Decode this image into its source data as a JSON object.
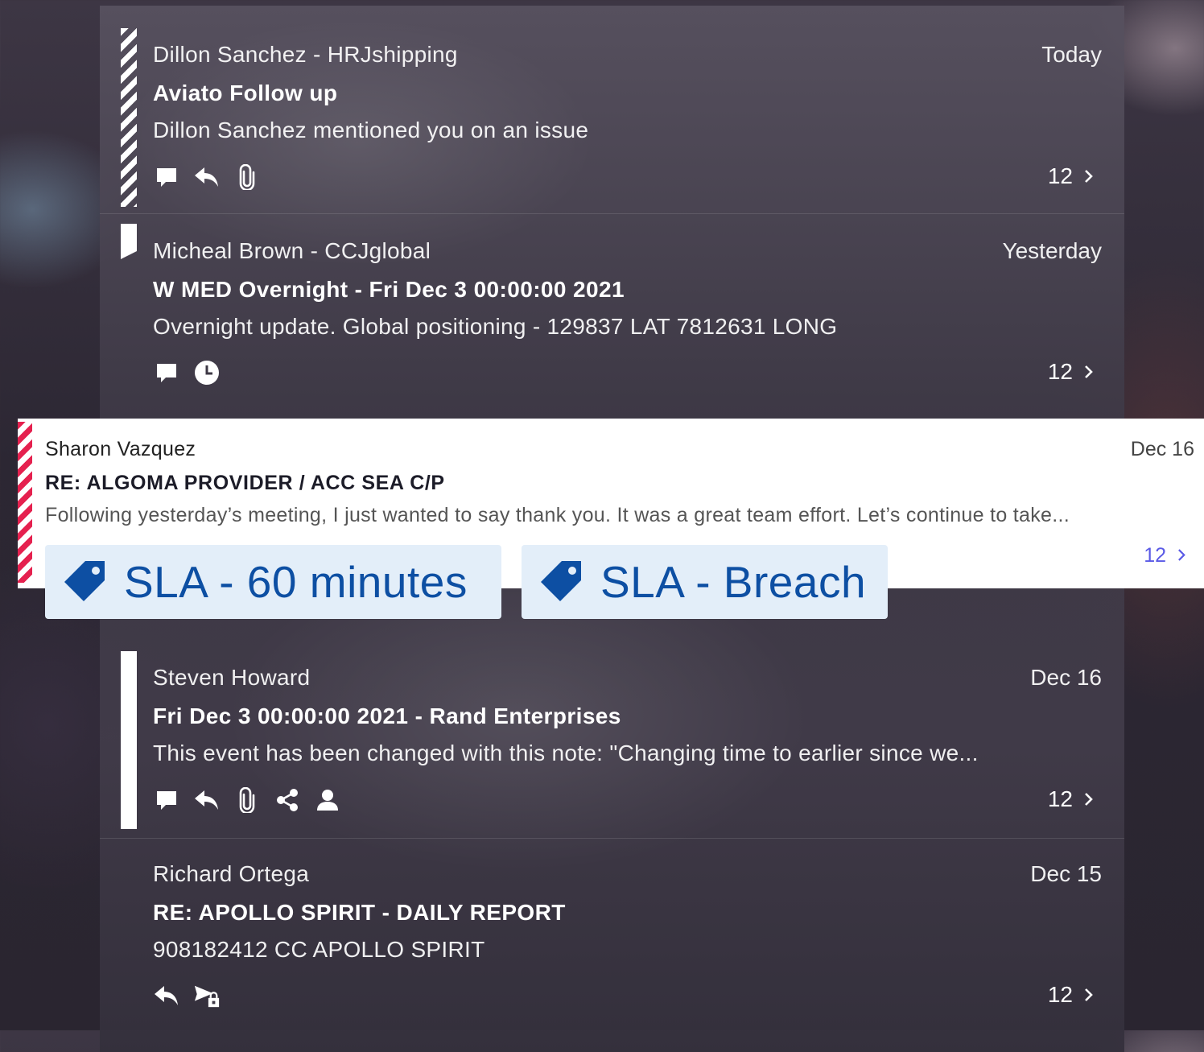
{
  "messages": [
    {
      "sender": "Dillon Sanchez - HRJshipping",
      "date": "Today",
      "subject": "Aviato Follow up",
      "preview": "Dillon Sanchez mentioned you on an issue",
      "count": "12",
      "icons": [
        "comment-icon",
        "reply-icon",
        "attachment-icon"
      ]
    },
    {
      "sender": "Micheal Brown - CCJglobal",
      "date": "Yesterday",
      "subject": "W MED Overnight - Fri Dec  3 00:00:00 2021",
      "preview": "Overnight update. Global positioning - 129837 LAT 7812631 LONG",
      "count": "12",
      "icons": [
        "comment-icon",
        "clock-icon"
      ]
    },
    {
      "sender": "Sharon Vazquez",
      "date": "Dec 16",
      "subject": "RE: ALGOMA PROVIDER / ACC SEA C/P",
      "preview": "Following yesterday’s meeting, I just wanted to say thank you. It was a great team effort. Let’s continue to take...",
      "count": "12",
      "tags": [
        "SLA - 60 minutes",
        "SLA - Breach"
      ]
    },
    {
      "sender": "Steven Howard",
      "date": "Dec 16",
      "subject": "Fri Dec  3 00:00:00 2021 - Rand Enterprises",
      "preview": "This event has been changed with this note: \"Changing time to earlier since we...",
      "count": "12",
      "icons": [
        "comment-icon",
        "reply-icon",
        "attachment-icon",
        "share-icon",
        "person-icon"
      ]
    },
    {
      "sender": "Richard Ortega",
      "date": "Dec 15",
      "subject": "RE: APOLLO SPIRIT - DAILY REPORT",
      "preview": "908182412 CC APOLLO SPIRIT",
      "count": "12",
      "icons": [
        "reply-icon",
        "forward-locked-icon"
      ]
    }
  ],
  "colors": {
    "highlight_stripe": "#e5214f",
    "tag_background": "#e3eef9",
    "tag_text": "#0d4fa3",
    "count_link_highlight": "#5a5ae6"
  }
}
